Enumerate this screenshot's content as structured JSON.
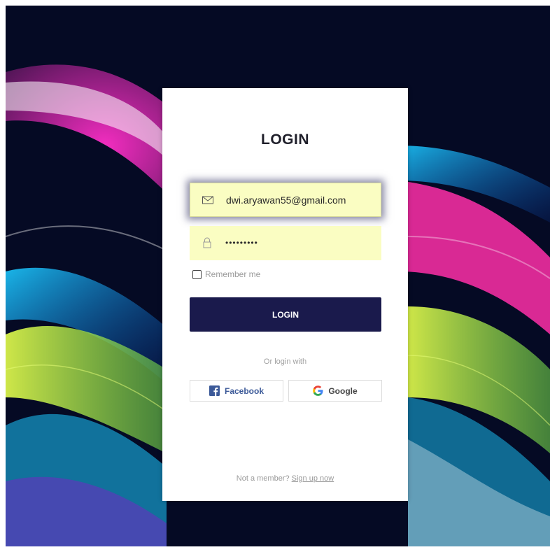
{
  "login": {
    "title": "LOGIN",
    "email": {
      "value": "dwi.aryawan55@gmail.com",
      "icon": "envelope-icon"
    },
    "password": {
      "value": "•••••••••",
      "icon": "lock-icon"
    },
    "remember_label": "Remember me",
    "submit_label": "LOGIN",
    "or_text": "Or login with",
    "social": {
      "facebook_label": "Facebook",
      "google_label": "Google"
    },
    "footer": {
      "prompt": "Not a member?",
      "signup_label": "Sign up now"
    }
  },
  "colors": {
    "button_bg": "#1a1a4c",
    "field_bg": "#fafdc2",
    "facebook": "#3b5998"
  }
}
